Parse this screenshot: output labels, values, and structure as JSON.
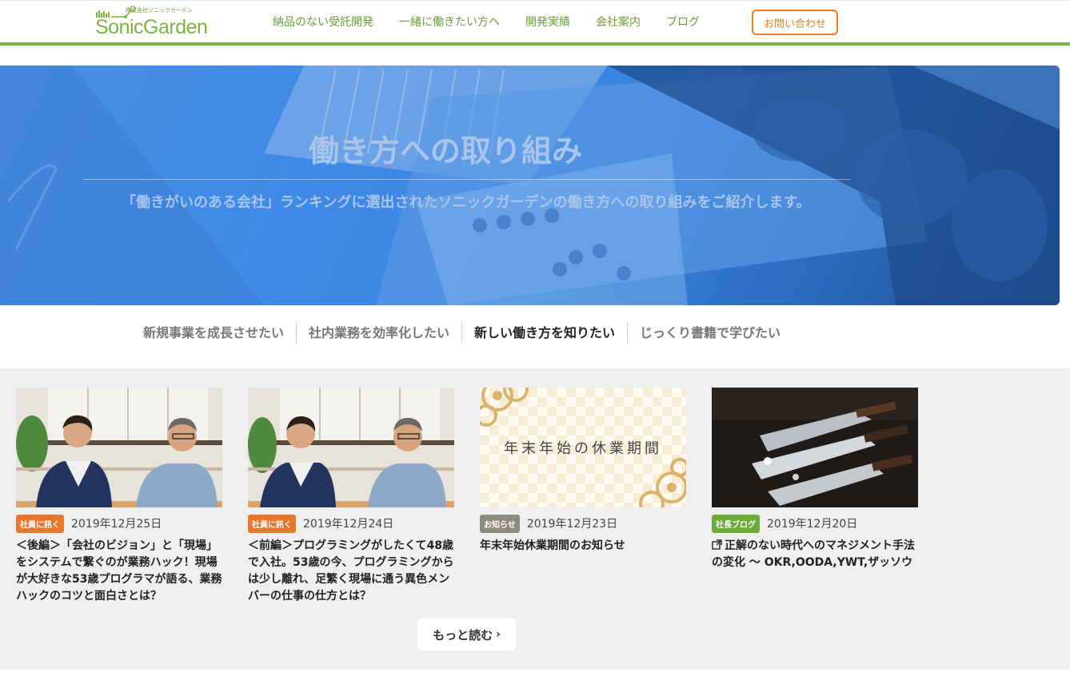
{
  "header": {
    "logo_sub": "株式会社ソニックガーデン",
    "logo_text": "SonicGarden",
    "nav": [
      "納品のない受託開発",
      "一緒に働きたい方へ",
      "開発実績",
      "会社案内",
      "ブログ"
    ],
    "contact": "お問い合わせ"
  },
  "hero": {
    "title": "働き方への取り組み",
    "description": "「働きがいのある会社」ランキングに選出されたソニックガーデンの働き方への取り組みをご紹介します。"
  },
  "tabs": [
    {
      "label": "新規事業を成長させたい",
      "active": false
    },
    {
      "label": "社内業務を効率化したい",
      "active": false
    },
    {
      "label": "新しい働き方を知りたい",
      "active": true
    },
    {
      "label": "じっくり書籍で学びたい",
      "active": false
    }
  ],
  "posts": [
    {
      "badge": "社員に訊く",
      "badge_color": "#e8772e",
      "date": "2019年12月25日",
      "title": "＜後編＞「会社のビジョン」と「現場」をシステムで繋ぐのが業務ハック！現場が大好きな53歳プログラマが語る、業務ハックのコツと面白さとは？"
    },
    {
      "badge": "社員に訊く",
      "badge_color": "#e8772e",
      "date": "2019年12月24日",
      "title": "＜前編＞プログラミングがしたくて48歳で入社。53歳の今、プログラミングからは少し離れ、足繁く現場に通う異色メンバーの仕事の仕方とは？"
    },
    {
      "badge": "お知らせ",
      "badge_color": "#8d8a80",
      "date": "2019年12月23日",
      "title": "年末年始休業期間のお知らせ",
      "thumb_text": "年末年始の休業期間"
    },
    {
      "badge": "社長ブログ",
      "badge_color": "#6aab3a",
      "date": "2019年12月20日",
      "title": "正解のない時代へのマネジメント手法の変化 〜 OKR,OODA,YWT,ザッソウ",
      "external": true
    }
  ],
  "more": "もっと読む"
}
